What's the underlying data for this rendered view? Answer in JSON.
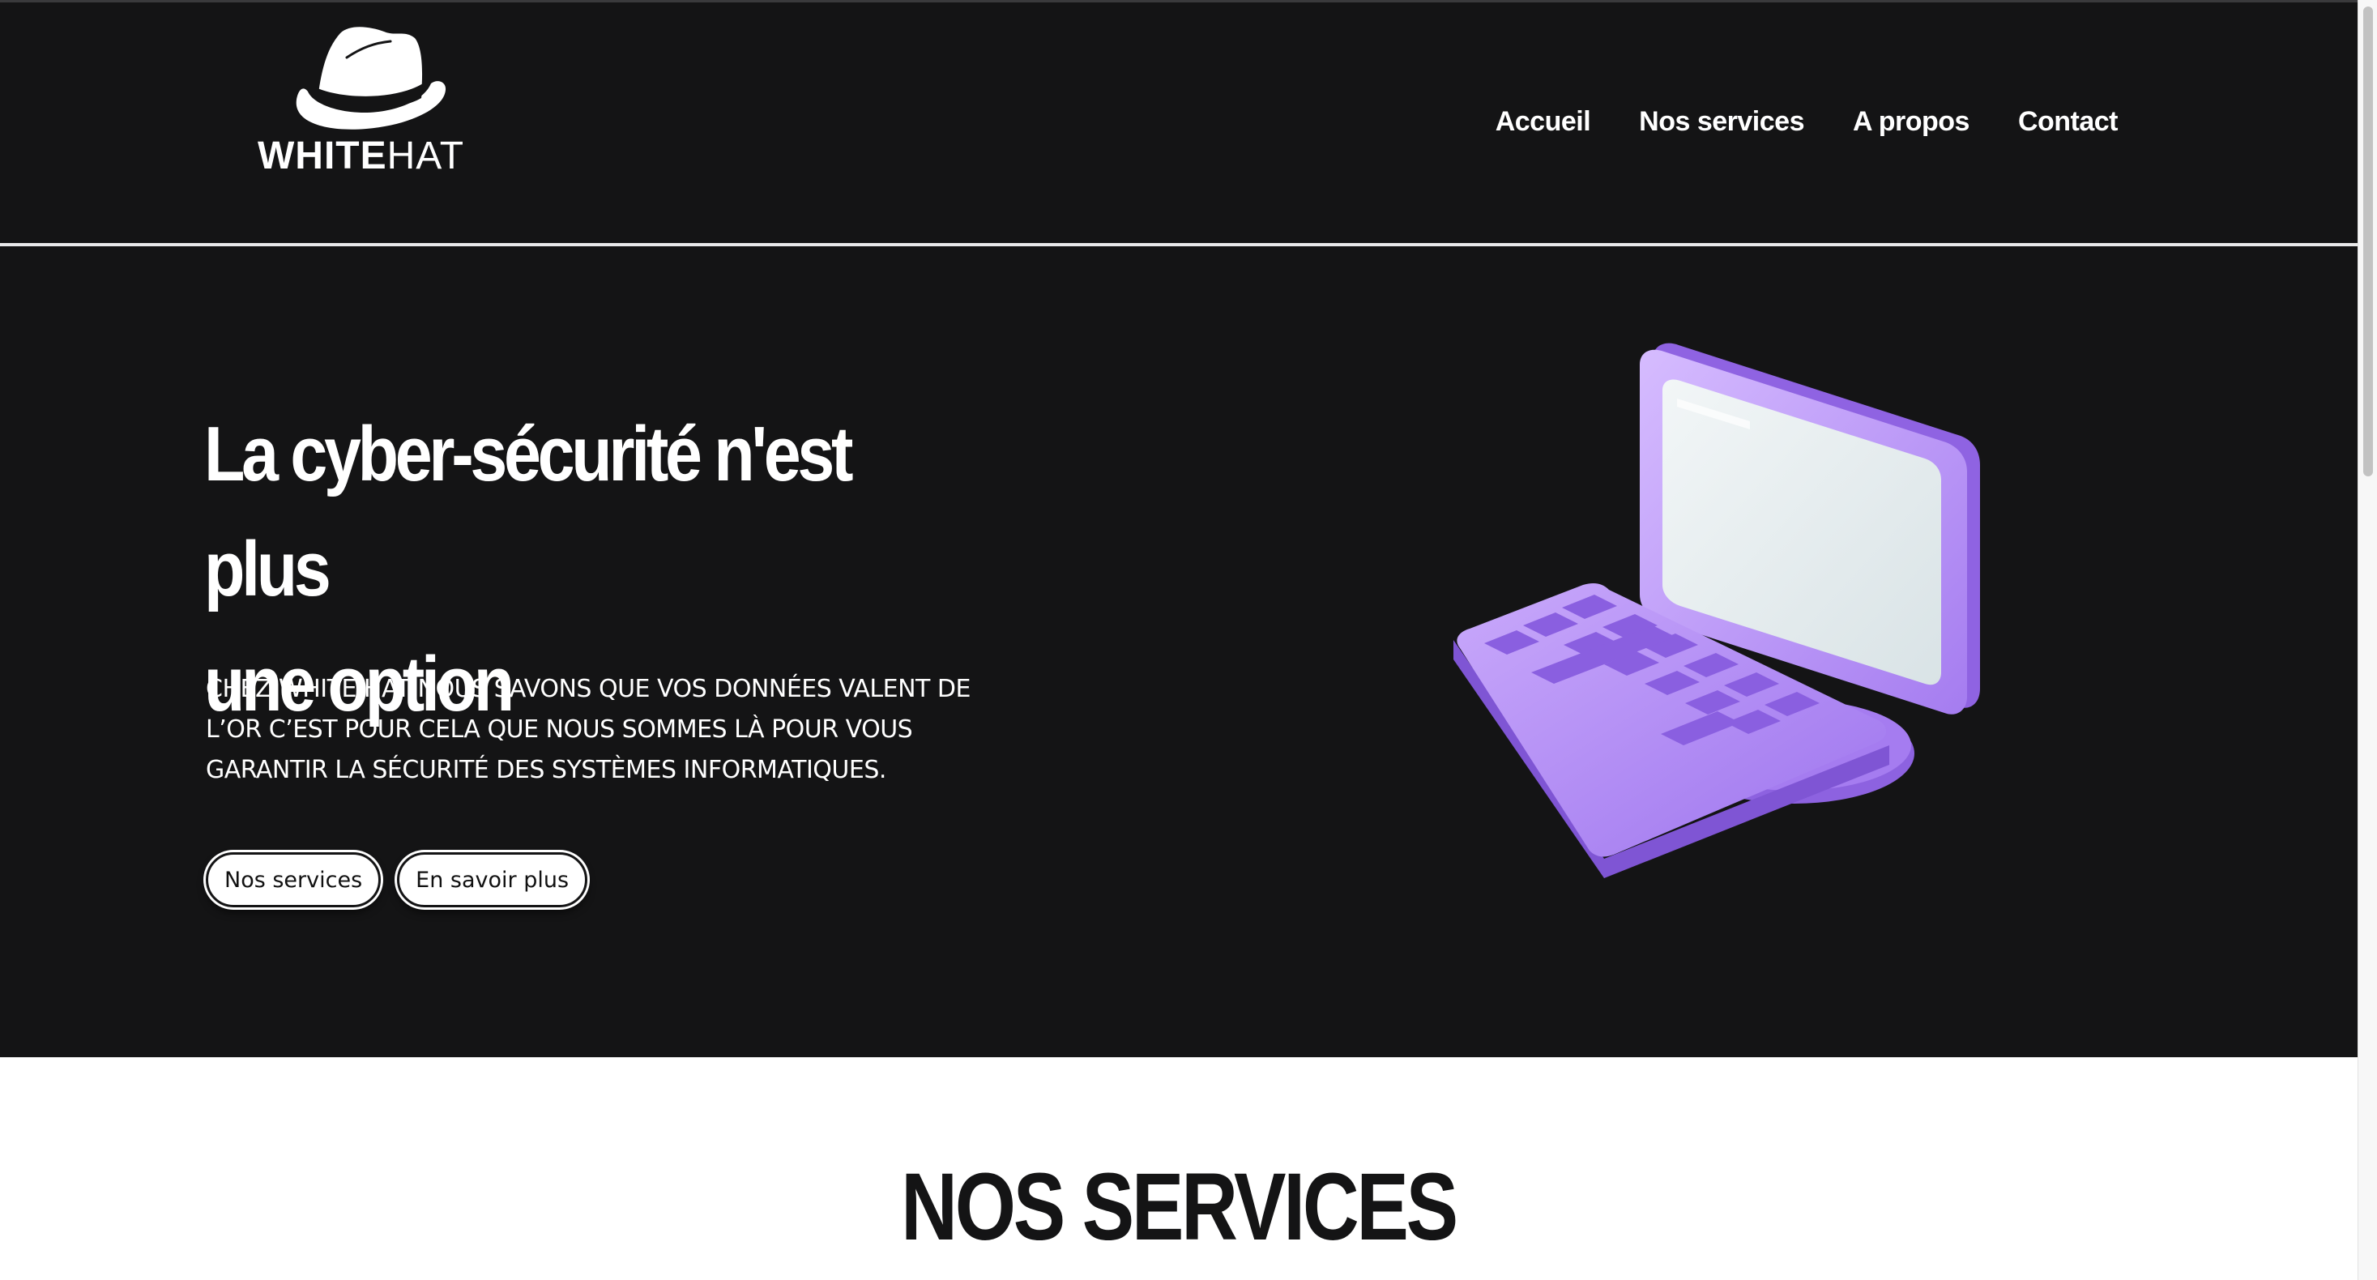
{
  "header": {
    "logo": {
      "text_bold": "WHITE",
      "text_thin": "HAT",
      "icon": "fedora-hat-icon"
    },
    "nav": [
      {
        "label": "Accueil"
      },
      {
        "label": "Nos services"
      },
      {
        "label": "A propos"
      },
      {
        "label": "Contact"
      }
    ]
  },
  "hero": {
    "title_line1": "La cyber-sécurité n'est plus",
    "title_line2": "une option",
    "description": "CHEZ WHITE HAT NOUS SAVONS QUE VOS DONNÉES VALENT DE L’OR C’EST POUR CELA QUE NOUS SOMMES LÀ POUR VOUS GARANTIR LA SÉCURITÉ DES SYSTÈMES INFORMATIQUES.",
    "buttons": {
      "services": "Nos services",
      "more": "En savoir plus"
    },
    "illustration": "purple-computer-keyboard-icon"
  },
  "services": {
    "title": "NOS SERVICES"
  },
  "colors": {
    "background_dark": "#141415",
    "text_light": "#ffffff",
    "accent_purple": "#a57cf0",
    "screen": "#e8eef0"
  }
}
